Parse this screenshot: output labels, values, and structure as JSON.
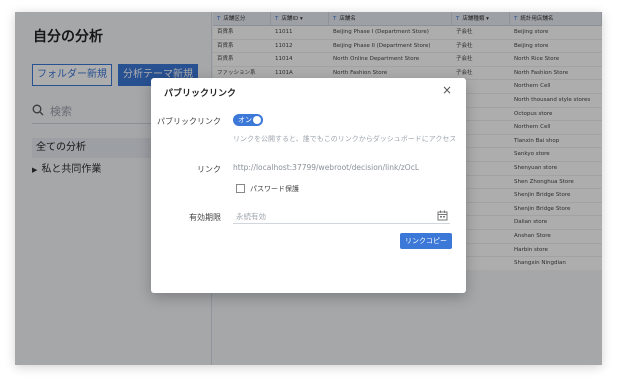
{
  "sidebar": {
    "title": "自分の分析",
    "folder_button": "フォルダー新規",
    "theme_button": "分析テーマ新規",
    "search_placeholder": "検索",
    "items": [
      {
        "label": "全ての分析"
      },
      {
        "label": "私と共同作業"
      }
    ]
  },
  "table": {
    "columns": [
      "店舗区分",
      "店舗ID",
      "店舗名",
      "店舗種類",
      "統計用店舗名"
    ],
    "rows": [
      [
        "百貨系",
        "11011",
        "Beijing Phase I (Department Store)",
        "子会社",
        "Beijing store"
      ],
      [
        "百貨系",
        "11012",
        "Beijing Phase II (Department Store)",
        "子会社",
        "Beijing store"
      ],
      [
        "百貨系",
        "11014",
        "North Online Department Store",
        "子会社",
        "North Rice Store"
      ],
      [
        "ファッション系",
        "1101A",
        "North Fashion Store",
        "子会社",
        "North Fashion Store"
      ],
      [
        "",
        "",
        "",
        "社",
        "Northern Cell"
      ],
      [
        "",
        "",
        "",
        "社",
        "North thousand style stores"
      ],
      [
        "",
        "",
        "",
        "先",
        "Octopus store"
      ],
      [
        "",
        "",
        "",
        "盟",
        "Northern Cell"
      ],
      [
        "",
        "",
        "",
        "社",
        "Tianxin Bai shop"
      ],
      [
        "",
        "",
        "",
        "社",
        "Sankyo store"
      ],
      [
        "",
        "",
        "",
        "社",
        "Shenyuan store"
      ],
      [
        "",
        "",
        "",
        "社",
        "Shen Zhonghua Store"
      ],
      [
        "",
        "",
        "",
        "社",
        "Shenjin Bridge Store"
      ],
      [
        "",
        "",
        "",
        "社",
        "Shenjin Bridge Store"
      ],
      [
        "",
        "",
        "",
        "盟",
        "Dalian store"
      ],
      [
        "",
        "",
        "",
        "社",
        "Anshan Store"
      ],
      [
        "",
        "",
        "",
        "社",
        "Harbin store"
      ],
      [
        "",
        "",
        "",
        "社",
        "Shangxin Ningdian"
      ]
    ]
  },
  "dialog": {
    "title": "パブリックリンク",
    "public_link_label": "パブリックリンク",
    "toggle_text": "オン",
    "hint": "リンクを公開すると、誰でもこのリンクからダッシュボードにアクセスで…",
    "link_label": "リンク",
    "link_value": "http://localhost:37799/webroot/decision/link/zOcL",
    "password_label": "パスワード保護",
    "expire_label": "有効期限",
    "expire_value": "永続有効",
    "copy_button": "リンクコピー"
  },
  "colors": {
    "accent": "#3c78d8",
    "overlay": "rgba(0,0,0,0.32)"
  }
}
